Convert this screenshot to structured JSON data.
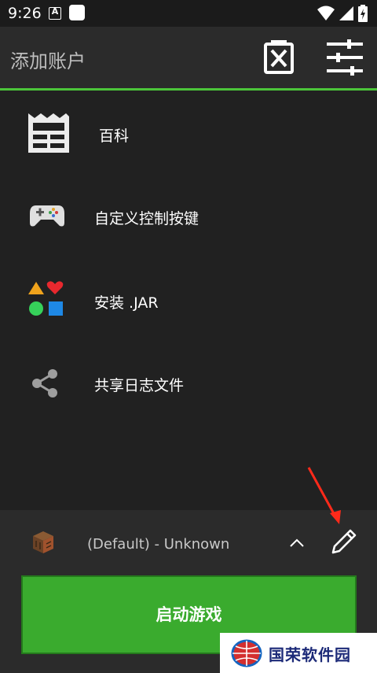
{
  "status_bar": {
    "time": "9:26",
    "notification_letter": "A"
  },
  "toolbar": {
    "title": "添加账户",
    "delete_icon": "delete-box-icon",
    "settings_icon": "sliders-icon"
  },
  "menu": {
    "items": [
      {
        "label": "百科",
        "icon": "wiki-icon"
      },
      {
        "label": "自定义控制按键",
        "icon": "gamepad-icon"
      },
      {
        "label": "安装 .JAR",
        "icon": "shapes-icon"
      },
      {
        "label": "共享日志文件",
        "icon": "share-icon"
      }
    ]
  },
  "profile": {
    "text": "(Default) - Unknown"
  },
  "launch": {
    "label": "启动游戏"
  },
  "watermark": {
    "text": "国荣软件园"
  },
  "colors": {
    "accent": "#4cc63a",
    "launch": "#3aab2e",
    "background": "#212121",
    "annotation_arrow": "#ff2a1a"
  }
}
